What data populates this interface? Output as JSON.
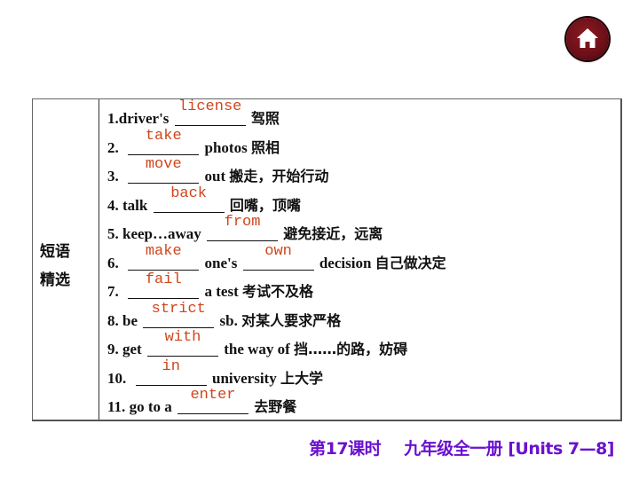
{
  "home_button": {
    "icon": "home-icon",
    "color": "#6b0f18"
  },
  "section_label": {
    "line1": "短语",
    "line2": "精选"
  },
  "answer_color": "#d0451b",
  "items": [
    {
      "num": "1.",
      "parts": [
        {
          "t": "driver's "
        },
        {
          "a": "license"
        },
        {
          "t": " "
        },
        {
          "cn": "驾照"
        }
      ]
    },
    {
      "num": "2.",
      "parts": [
        {
          "t": "  "
        },
        {
          "a": "take"
        },
        {
          "t": " photos "
        },
        {
          "cn": "照相"
        }
      ]
    },
    {
      "num": "3.",
      "parts": [
        {
          "t": "  "
        },
        {
          "a": "move"
        },
        {
          "t": " out "
        },
        {
          "cn": "搬走，开始行动"
        }
      ]
    },
    {
      "num": "4.",
      "parts": [
        {
          "t": " talk "
        },
        {
          "a": "back"
        },
        {
          "t": " "
        },
        {
          "cn": "回嘴，顶嘴"
        }
      ]
    },
    {
      "num": "5.",
      "parts": [
        {
          "t": " keep…away "
        },
        {
          "a": "from"
        },
        {
          "t": " "
        },
        {
          "cn": "避免接近，远离"
        }
      ]
    },
    {
      "num": "6.",
      "parts": [
        {
          "t": "  "
        },
        {
          "a": "make"
        },
        {
          "t": " one's "
        },
        {
          "a": "own"
        },
        {
          "t": " decision "
        },
        {
          "cn": "自己做决定"
        }
      ]
    },
    {
      "num": "7.",
      "parts": [
        {
          "t": "  "
        },
        {
          "a": "fail"
        },
        {
          "t": " a test "
        },
        {
          "cn": "考试不及格"
        }
      ]
    },
    {
      "num": "8.",
      "parts": [
        {
          "t": " be "
        },
        {
          "a": "strict"
        },
        {
          "t": " sb. "
        },
        {
          "cn": "对某人要求严格"
        }
      ]
    },
    {
      "num": "9.",
      "parts": [
        {
          "t": " get "
        },
        {
          "a": "with"
        },
        {
          "t": " the way of "
        },
        {
          "cn": "挡……的路，妨碍"
        }
      ]
    },
    {
      "num": "10.",
      "parts": [
        {
          "t": "  "
        },
        {
          "a": "in"
        },
        {
          "t": " university "
        },
        {
          "cn": "上大学"
        }
      ]
    },
    {
      "num": "11.",
      "parts": [
        {
          "t": " go to a "
        },
        {
          "a": "enter"
        },
        {
          "t": " "
        },
        {
          "cn": "去野餐"
        }
      ]
    }
  ],
  "footer": {
    "lesson": "第17课时",
    "book": "九年级全一册 [Units 7—8]",
    "color": "#6a11cf"
  }
}
